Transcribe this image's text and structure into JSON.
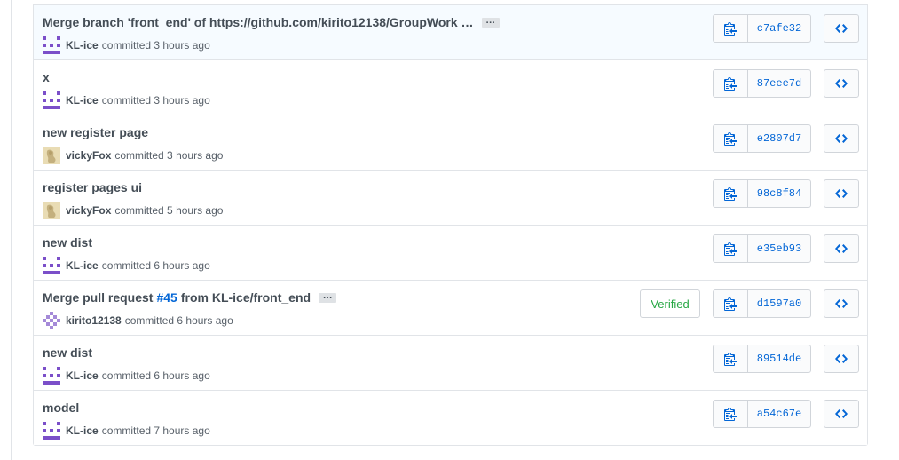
{
  "commits": [
    {
      "message": "Merge branch 'front_end' of https://github.com/kirito12138/GroupWork …",
      "has_ellipsis": true,
      "author": "KL-ice",
      "avatar": "kl-ice",
      "time": "committed 3 hours ago",
      "sha": "c7afe32",
      "verified": null,
      "highlight": true
    },
    {
      "message": "x",
      "has_ellipsis": false,
      "author": "KL-ice",
      "avatar": "kl-ice",
      "time": "committed 3 hours ago",
      "sha": "87eee7d",
      "verified": null
    },
    {
      "message": "new register page",
      "has_ellipsis": false,
      "author": "vickyFox",
      "avatar": "vickyfox",
      "time": "committed 3 hours ago",
      "sha": "e2807d7",
      "verified": null
    },
    {
      "message": "register pages ui",
      "has_ellipsis": false,
      "author": "vickyFox",
      "avatar": "vickyfox",
      "time": "committed 5 hours ago",
      "sha": "98c8f84",
      "verified": null
    },
    {
      "message": "new dist",
      "has_ellipsis": false,
      "author": "KL-ice",
      "avatar": "kl-ice",
      "time": "committed 6 hours ago",
      "sha": "e35eb93",
      "verified": null
    },
    {
      "message_prefix": "Merge pull request ",
      "pr_link": "#45",
      "message_suffix": " from KL-ice/front_end",
      "has_ellipsis": true,
      "author": "kirito12138",
      "avatar": "kirito",
      "time": "committed 6 hours ago",
      "sha": "d1597a0",
      "verified": "Verified"
    },
    {
      "message": "new dist",
      "has_ellipsis": false,
      "author": "KL-ice",
      "avatar": "kl-ice",
      "time": "committed 6 hours ago",
      "sha": "89514de",
      "verified": null
    },
    {
      "message": "model",
      "has_ellipsis": false,
      "author": "KL-ice",
      "avatar": "kl-ice",
      "time": "committed 7 hours ago",
      "sha": "a54c67e",
      "verified": null
    }
  ],
  "labels": {
    "ellipsis": "…"
  },
  "icons": {
    "copy": "clippy-icon",
    "browse": "code-icon"
  },
  "colors": {
    "link": "#0366d6",
    "verified": "#28a745",
    "kl_ice_avatar": "#7b4fc9",
    "border": "#e1e4e8"
  }
}
